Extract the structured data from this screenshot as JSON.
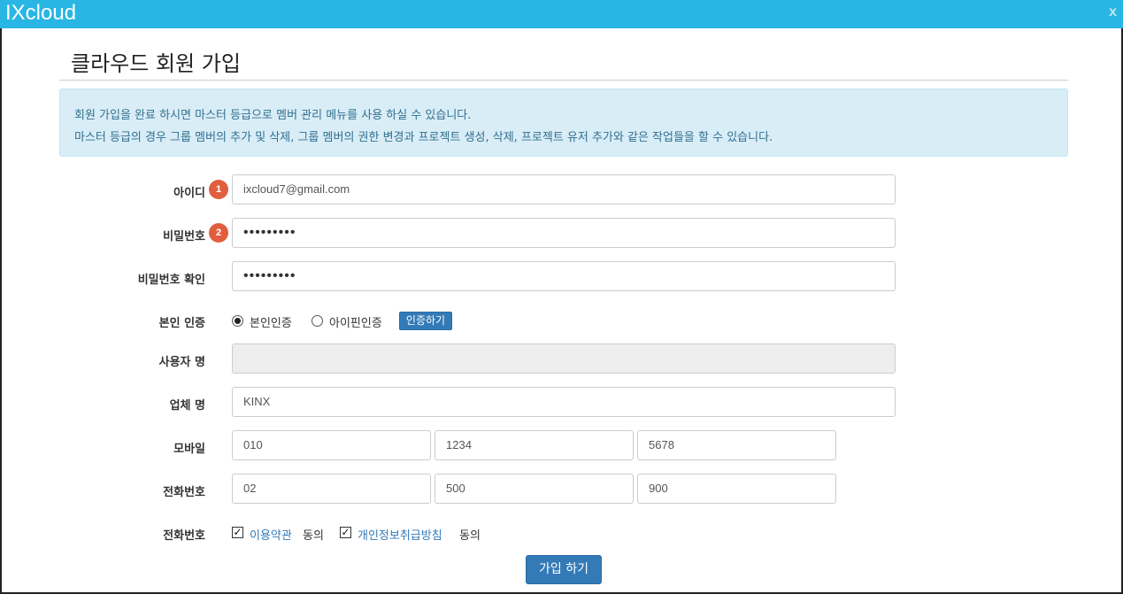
{
  "window": {
    "brand": "IXcloud",
    "close": "x"
  },
  "page": {
    "title": "클라우드 회원 가입"
  },
  "notice": {
    "line1": "회원 가입을 완료 하시면 마스터 등급으로 멤버 관리 메뉴를 사용 하실 수 있습니다.",
    "line2": "마스터 등급의 경우 그룹 멤버의 추가 및 삭제, 그룹 멤버의 권한 변경과 프로젝트 생성, 삭제, 프로젝트 유저 추가와 같은 작업들을 할 수 있습니다."
  },
  "form": {
    "id": {
      "label": "아이디",
      "badge": "1",
      "value": "ixcloud7@gmail.com"
    },
    "password": {
      "label": "비밀번호",
      "badge": "2",
      "value": "•••••••••"
    },
    "password_confirm": {
      "label": "비밀번호 확인",
      "value": "•••••••••"
    },
    "verify": {
      "label": "본인 인증",
      "option1": "본인인증",
      "option2": "아이핀인증",
      "selected": "본인인증",
      "button": "인증하기"
    },
    "username": {
      "label": "사용자 명",
      "value": ""
    },
    "company": {
      "label": "업체 명",
      "value": "KINX"
    },
    "mobile": {
      "label": "모바일",
      "part1": "010",
      "part2": "1234",
      "part3": "5678"
    },
    "phone": {
      "label": "전화번호",
      "part1": "02",
      "part2": "500",
      "part3": "900"
    },
    "agreements": {
      "label": "전화번호",
      "terms_link": "이용약관",
      "terms_suffix": "동의",
      "privacy_link": "개인정보취급방침",
      "privacy_suffix": "동의",
      "terms_checked": true,
      "privacy_checked": true
    },
    "submit": "가입 하기"
  },
  "colors": {
    "titlebar": "#29b6e4",
    "primary": "#337ab7",
    "badge": "#e05e3e",
    "alert_bg": "#d9edf7"
  }
}
